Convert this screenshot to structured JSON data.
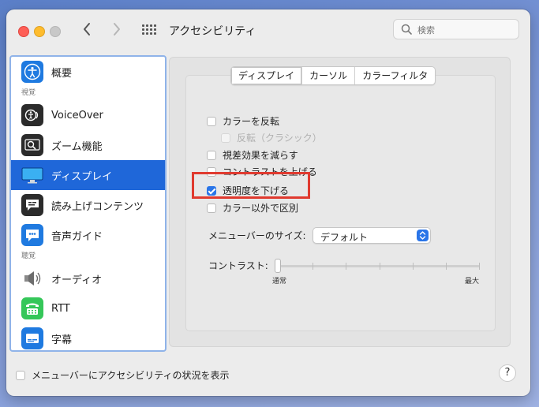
{
  "window": {
    "title": "アクセシビリティ"
  },
  "search": {
    "placeholder": "検索"
  },
  "sidebar": {
    "items": [
      {
        "label": "概要",
        "icon": "accessibility-icon"
      },
      {
        "section": "視覚"
      },
      {
        "label": "VoiceOver",
        "icon": "voiceover-icon"
      },
      {
        "label": "ズーム機能",
        "icon": "zoom-icon"
      },
      {
        "label": "ディスプレイ",
        "icon": "display-icon",
        "selected": true
      },
      {
        "label": "読み上げコンテンツ",
        "icon": "spoken-content-icon"
      },
      {
        "label": "音声ガイド",
        "icon": "descriptions-icon"
      },
      {
        "section": "聴覚"
      },
      {
        "label": "オーディオ",
        "icon": "speaker-icon"
      },
      {
        "label": "RTT",
        "icon": "rtt-icon"
      },
      {
        "label": "字幕",
        "icon": "captions-icon"
      }
    ],
    "section_vision": "視覚",
    "section_hearing": "聴覚"
  },
  "tabs": [
    {
      "label": "ディスプレイ",
      "active": true
    },
    {
      "label": "カーソル"
    },
    {
      "label": "カラーフィルタ"
    }
  ],
  "options": {
    "invert_colors": {
      "label": "カラーを反転",
      "checked": false
    },
    "classic_invert": {
      "label": "反転（クラシック）",
      "checked": false,
      "disabled": true
    },
    "reduce_motion": {
      "label": "視差効果を減らす",
      "checked": false
    },
    "increase_contrast": {
      "label": "コントラストを上げる",
      "checked": false
    },
    "reduce_transparency": {
      "label": "透明度を下げる",
      "checked": true
    },
    "differentiate_without_color": {
      "label": "カラー以外で区別",
      "checked": false
    }
  },
  "menu_bar_size": {
    "label": "メニューバーのサイズ:",
    "value": "デフォルト"
  },
  "contrast": {
    "label": "コントラスト:",
    "min_label": "通常",
    "max_label": "最大",
    "value": 0
  },
  "bottom": {
    "show_status_label": "メニューバーにアクセシビリティの状況を表示",
    "checked": false
  },
  "help_label": "?",
  "colors": {
    "accent": "#1f67d9",
    "highlight": "#e03a2f"
  }
}
